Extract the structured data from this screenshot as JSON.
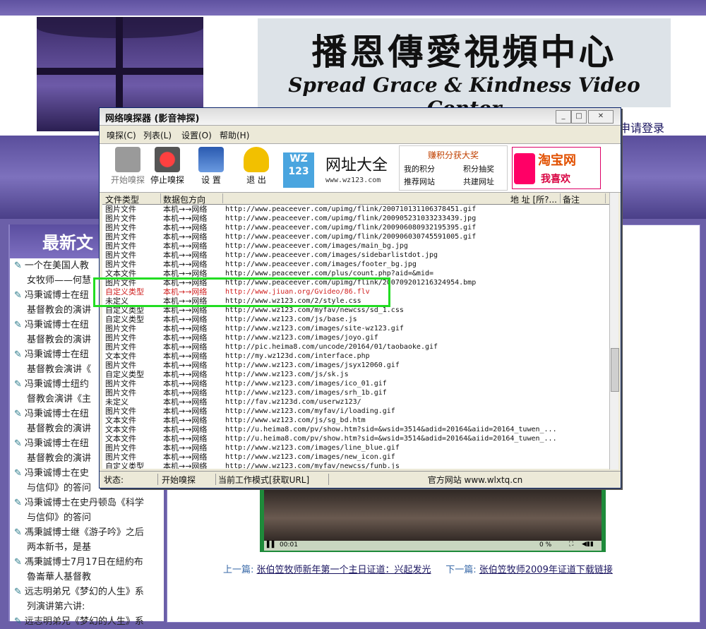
{
  "site": {
    "banner_cn": "播恩傳愛視頻中心",
    "banner_en": "Spread Grace & Kindness Video Center",
    "login_link": "申请登录",
    "left_heading": "最新文",
    "news_items": [
      "一个在美国人教",
      "女牧师——何慧",
      "冯秉诚博士在纽",
      "基督教会的演讲",
      "冯秉诚博士在纽",
      "基督教会的演讲",
      "冯秉诚博士在纽",
      "基督教会演讲《",
      "冯秉诚博士纽约",
      "督教会演讲《主",
      "冯秉诚博士在纽",
      "基督教会的演讲",
      "冯秉诚博士在纽",
      "基督教会的演讲",
      "冯秉诚博士在史",
      "与信仰》的答问",
      "冯秉诚博士在史丹顿岛《科学",
      "与信仰》的答问",
      "馮秉誠博士继《游子吟》之后",
      "两本新书，是基",
      "馮秉誠博士7月17日在紐約布",
      "魯崙華人基督教",
      "远志明弟兄《梦幻的人生》系",
      "列演讲第六讲:",
      "远志明弟兄《梦幻的人生》系"
    ],
    "prev_label": "上一篇:",
    "prev_link": "张伯笠牧师新年第一个主日证道：兴起发光",
    "next_label": "下一篇:",
    "next_link": "张伯笠牧师2009年证道下载链接",
    "video_time": "00:01",
    "video_volume": "0 %"
  },
  "sniffer": {
    "title": "网络嗅探器 (影音神探)",
    "menus": [
      "嗅探(C)",
      "列表(L)",
      "设置(O)",
      "帮助(H)"
    ],
    "tools": {
      "start": "开始嗅探",
      "stop": "停止嗅探",
      "settings": "设 置",
      "exit": "退 出"
    },
    "ad_wz123": {
      "logo_line1": "WZ",
      "logo_line2": "123",
      "title": "网址大全",
      "url": "www.wz123.com"
    },
    "ad_points": {
      "heading": "赚积分获大奖",
      "a": "我的积分",
      "b": "积分抽奖",
      "c": "推荐网站",
      "d": "共建网址"
    },
    "ad_taobao": {
      "t1": "淘宝网",
      "t2": "我喜欢"
    },
    "columns": [
      "文件类型",
      "数据包方向",
      "地 址 [所?...",
      "备注"
    ],
    "rows": [
      {
        "type": "图片文件",
        "dir": "本机→→网络",
        "url": "http://www.peaceever.com/upimg/flink/200710131106378451.gif"
      },
      {
        "type": "图片文件",
        "dir": "本机→→网络",
        "url": "http://www.peaceever.com/upimg/flink/200905231033233439.jpg"
      },
      {
        "type": "图片文件",
        "dir": "本机→→网络",
        "url": "http://www.peaceever.com/upimg/flink/200906080932195395.gif"
      },
      {
        "type": "图片文件",
        "dir": "本机→→网络",
        "url": "http://www.peaceever.com/upimg/flink/200906030745591005.gif"
      },
      {
        "type": "图片文件",
        "dir": "本机→→网络",
        "url": "http://www.peaceever.com/images/main_bg.jpg"
      },
      {
        "type": "图片文件",
        "dir": "本机→→网络",
        "url": "http://www.peaceever.com/images/sidebarlistdot.jpg"
      },
      {
        "type": "图片文件",
        "dir": "本机→→网络",
        "url": "http://www.peaceever.com/images/footer_bg.jpg"
      },
      {
        "type": "文本文件",
        "dir": "本机→→网络",
        "url": "http://www.peaceever.com/plus/count.php?aid=&mid="
      },
      {
        "type": "图片文件",
        "dir": "本机→→网络",
        "url": "http://www.peaceever.com/upimg/flink/200709201216324954.bmp"
      },
      {
        "type": "自定义类型",
        "dir": "本机→→网络",
        "url": "http://www.jiuan.org/Gvideo/86.flv",
        "highlight": true
      },
      {
        "type": "未定义",
        "dir": "本机→→网络",
        "url": "http://www.wz123.com/2/style.css"
      },
      {
        "type": "自定义类型",
        "dir": "本机→→网络",
        "url": "http://www.wz123.com/myfav/newcss/sd_1.css"
      },
      {
        "type": "自定义类型",
        "dir": "本机→→网络",
        "url": "http://www.wz123.com/js/base.js"
      },
      {
        "type": "图片文件",
        "dir": "本机→→网络",
        "url": "http://www.wz123.com/images/site-wz123.gif"
      },
      {
        "type": "图片文件",
        "dir": "本机→→网络",
        "url": "http://www.wz123.com/images/joyo.gif"
      },
      {
        "type": "图片文件",
        "dir": "本机→→网络",
        "url": "http://pic.heima8.com/uncode/20164/01/taobaoke.gif"
      },
      {
        "type": "文本文件",
        "dir": "本机→→网络",
        "url": "http://my.wz123d.com/interface.php"
      },
      {
        "type": "图片文件",
        "dir": "本机→→网络",
        "url": "http://www.wz123.com/images/jsyx12060.gif"
      },
      {
        "type": "自定义类型",
        "dir": "本机→→网络",
        "url": "http://www.wz123.com/js/sk.js"
      },
      {
        "type": "图片文件",
        "dir": "本机→→网络",
        "url": "http://www.wz123.com/images/ico_01.gif"
      },
      {
        "type": "图片文件",
        "dir": "本机→→网络",
        "url": "http://www.wz123.com/images/srh_1b.gif"
      },
      {
        "type": "未定义",
        "dir": "本机→→网络",
        "url": "http://fav.wz123d.com/userwz123/"
      },
      {
        "type": "图片文件",
        "dir": "本机→→网络",
        "url": "http://www.wz123.com/myfav/i/loading.gif"
      },
      {
        "type": "文本文件",
        "dir": "本机→→网络",
        "url": "http://www.wz123.com/js/sg_bd.htm"
      },
      {
        "type": "文本文件",
        "dir": "本机→→网络",
        "url": "http://u.heima8.com/pv/show.htm?sid=&wsid=3514&adid=20164&aiid=20164_tuwen_..."
      },
      {
        "type": "文本文件",
        "dir": "本机→→网络",
        "url": "http://u.heima8.com/pv/show.htm?sid=&wsid=3514&adid=20164&aiid=20164_tuwen_..."
      },
      {
        "type": "图片文件",
        "dir": "本机→→网络",
        "url": "http://www.wz123.com/images/line_blue.gif"
      },
      {
        "type": "图片文件",
        "dir": "本机→→网络",
        "url": "http://www.wz123.com/images/new_icon.gif"
      },
      {
        "type": "自定义类型",
        "dir": "本机→→网络",
        "url": "http://www.wz123.com/myfav/newcss/funb.js"
      }
    ],
    "status": {
      "state_label": "状态:",
      "state_value": "开始嗅探",
      "mode": "当前工作模式[获取URL]",
      "site": "官方网站 www.wlxtq.cn"
    },
    "highlight_color": "#22dd22"
  }
}
